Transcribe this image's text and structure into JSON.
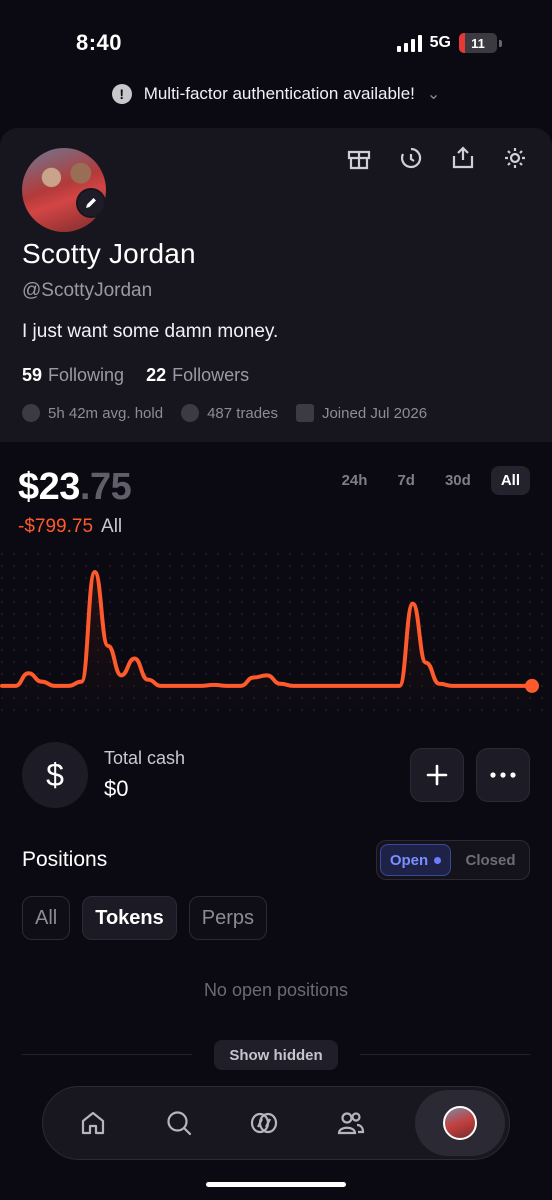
{
  "status": {
    "time": "8:40",
    "network": "5G",
    "battery": "11"
  },
  "banner": {
    "text": "Multi-factor authentication available!"
  },
  "profile": {
    "name": "Scotty Jordan",
    "handle": "@ScottyJordan",
    "bio": "I just want some damn money.",
    "following_count": "59",
    "following_label": "Following",
    "followers_count": "22",
    "followers_label": "Followers",
    "avg_hold": "5h 42m avg. hold",
    "trades": "487 trades",
    "joined": "Joined Jul 2026"
  },
  "portfolio": {
    "balance_whole": "$23",
    "balance_cents": ".75",
    "change": "-$799.75",
    "change_period": "All",
    "ranges": [
      "24h",
      "7d",
      "30d",
      "All"
    ],
    "active_range": "All",
    "line_color": "#ff5a2c"
  },
  "chart_data": {
    "type": "line",
    "x": [
      0,
      1,
      2,
      3,
      4,
      5,
      6,
      7,
      8,
      9,
      10,
      11,
      12,
      13,
      14,
      15,
      16,
      17,
      18,
      19,
      20,
      21,
      22,
      23,
      24,
      25,
      26,
      27,
      28,
      29,
      30,
      31,
      32,
      33,
      34,
      35,
      36,
      37,
      38,
      39,
      40
    ],
    "values": [
      2,
      2,
      14,
      6,
      2,
      2,
      6,
      110,
      40,
      12,
      28,
      8,
      2,
      2,
      2,
      2,
      3,
      2,
      2,
      10,
      12,
      4,
      2,
      2,
      2,
      2,
      2,
      2,
      2,
      2,
      2,
      80,
      24,
      4,
      2,
      2,
      2,
      2,
      2,
      2,
      2
    ],
    "title": "",
    "xlabel": "",
    "ylabel": ""
  },
  "cash": {
    "label": "Total cash",
    "value": "$0",
    "icon": "$"
  },
  "positions": {
    "title": "Positions",
    "toggle_open": "Open",
    "toggle_closed": "Closed",
    "filters": [
      "All",
      "Tokens",
      "Perps"
    ],
    "active_filter": "Tokens",
    "empty_text": "No open positions",
    "show_hidden": "Show hidden"
  },
  "nav": {
    "items": [
      "home-icon",
      "search-icon",
      "coins-icon",
      "people-icon",
      "profile-avatar"
    ]
  }
}
